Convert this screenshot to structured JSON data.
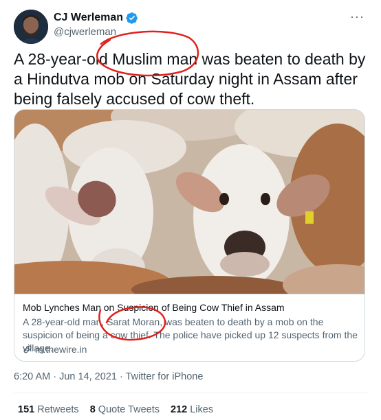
{
  "author": {
    "name": "CJ Werleman",
    "handle": "@cjwerleman"
  },
  "more_glyph": "···",
  "tweet_text": "A 28-year-old Muslim man was beaten to death by a Hindutva mob on Saturday night in Assam after being falsely accused of cow theft.",
  "card": {
    "image_subject": "close-up photo of a herd of white and brown cows",
    "title": "Mob Lynches Man on Suspicion of Being Cow Thief in Assam",
    "description": "A 28-year-old man, Sarat Moran, was beaten to death by a mob on the suspicion of being a cow thief. The police have picked up 12 suspects from the village.",
    "domain": "m.thewire.in"
  },
  "meta": {
    "time": "6:20 AM",
    "sep1": " · ",
    "date": "Jun 14, 2021",
    "sep2": " · ",
    "source": "Twitter for iPhone"
  },
  "stats": {
    "retweets_count": "151",
    "retweets_label": " Retweets",
    "quotes_count": "8",
    "quotes_label": " Quote Tweets",
    "likes_count": "212",
    "likes_label": " Likes"
  },
  "colors": {
    "verified": "#1d9bf0",
    "annotation_red": "#e0201b",
    "muted_text": "#536471"
  },
  "icons": [
    "verified-badge-icon",
    "more-options-icon",
    "link-icon"
  ]
}
